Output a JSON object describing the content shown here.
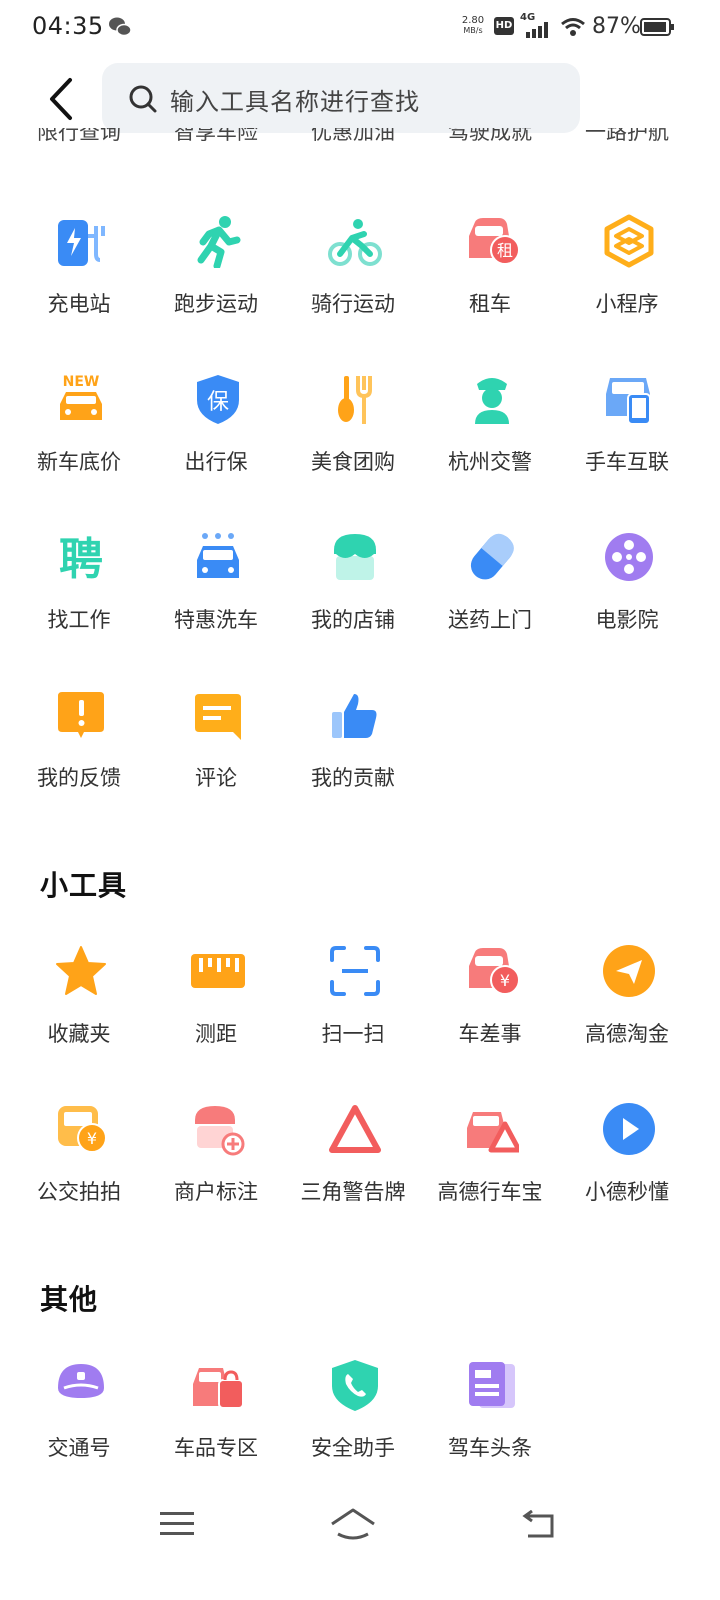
{
  "status_bar": {
    "time": "04:35",
    "speed_value": "2.80",
    "speed_unit": "MB/s",
    "hd": "HD",
    "network": "4G",
    "battery": "87%"
  },
  "search": {
    "placeholder": "输入工具名称进行查找"
  },
  "partial_row": [
    "限行查询",
    "智享车险",
    "优惠加油",
    "驾驶成就",
    "一路护航"
  ],
  "grid": [
    {
      "label": "充电站",
      "icon": "charging-station-icon"
    },
    {
      "label": "跑步运动",
      "icon": "running-icon"
    },
    {
      "label": "骑行运动",
      "icon": "cycling-icon"
    },
    {
      "label": "租车",
      "icon": "car-rental-icon"
    },
    {
      "label": "小程序",
      "icon": "mini-program-icon"
    },
    {
      "label": "新车底价",
      "icon": "new-car-icon"
    },
    {
      "label": "出行保",
      "icon": "travel-insurance-icon"
    },
    {
      "label": "美食团购",
      "icon": "food-icon"
    },
    {
      "label": "杭州交警",
      "icon": "traffic-police-icon"
    },
    {
      "label": "手车互联",
      "icon": "phone-car-link-icon"
    },
    {
      "label": "找工作",
      "icon": "job-icon"
    },
    {
      "label": "特惠洗车",
      "icon": "car-wash-icon"
    },
    {
      "label": "我的店铺",
      "icon": "shop-icon"
    },
    {
      "label": "送药上门",
      "icon": "medicine-icon"
    },
    {
      "label": "电影院",
      "icon": "cinema-icon"
    },
    {
      "label": "我的反馈",
      "icon": "feedback-icon"
    },
    {
      "label": "评论",
      "icon": "comment-icon"
    },
    {
      "label": "我的贡献",
      "icon": "thumbs-up-icon"
    }
  ],
  "tools": {
    "title": "小工具",
    "items": [
      {
        "label": "收藏夹",
        "icon": "star-icon"
      },
      {
        "label": "测距",
        "icon": "ruler-icon"
      },
      {
        "label": "扫一扫",
        "icon": "scan-icon"
      },
      {
        "label": "车差事",
        "icon": "car-errand-icon"
      },
      {
        "label": "高德淘金",
        "icon": "paper-plane-icon"
      },
      {
        "label": "公交拍拍",
        "icon": "bus-photo-icon"
      },
      {
        "label": "商户标注",
        "icon": "merchant-mark-icon"
      },
      {
        "label": "三角警告牌",
        "icon": "warning-triangle-icon"
      },
      {
        "label": "高德行车宝",
        "icon": "drive-guard-icon"
      },
      {
        "label": "小德秒懂",
        "icon": "play-icon"
      }
    ]
  },
  "others": {
    "title": "其他",
    "items": [
      {
        "label": "交通号",
        "icon": "traffic-hat-icon"
      },
      {
        "label": "车品专区",
        "icon": "car-goods-icon"
      },
      {
        "label": "安全助手",
        "icon": "safety-shield-icon"
      },
      {
        "label": "驾车头条",
        "icon": "news-icon"
      }
    ]
  },
  "colors": {
    "blue": "#3a8bf5",
    "teal": "#2fd3b0",
    "red": "#f25d5d",
    "orange": "#ffa318",
    "purple": "#a07cf0"
  }
}
